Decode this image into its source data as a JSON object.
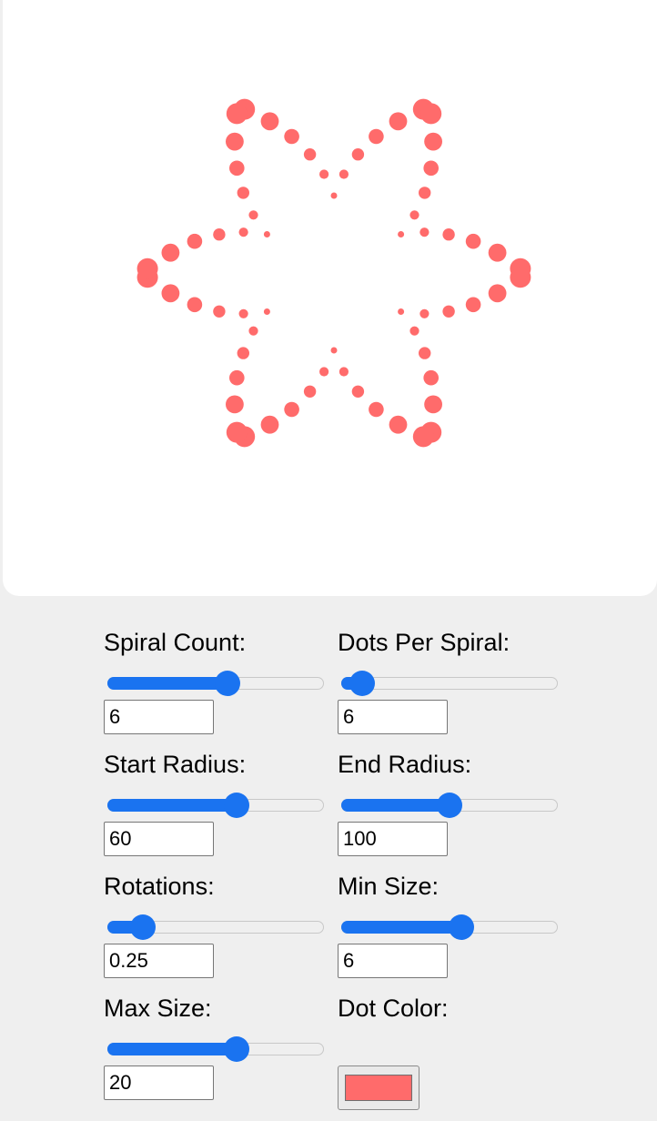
{
  "dot_color": "#ff6b6b",
  "accent_color": "#1a73f0",
  "controls": {
    "spiral_count": {
      "label": "Spiral Count:",
      "value": "6",
      "slider_fraction": 0.555
    },
    "dots_per_spiral": {
      "label": "Dots Per Spiral:",
      "value": "6",
      "slider_fraction": 0.095
    },
    "start_radius": {
      "label": "Start Radius:",
      "value": "60",
      "slider_fraction": 0.595
    },
    "end_radius": {
      "label": "End Radius:",
      "value": "100",
      "slider_fraction": 0.5
    },
    "rotations": {
      "label": "Rotations:",
      "value": "0.25",
      "slider_fraction": 0.165
    },
    "min_size": {
      "label": "Min Size:",
      "value": "6",
      "slider_fraction": 0.555
    },
    "max_size": {
      "label": "Max Size:",
      "value": "20",
      "slider_fraction": 0.595
    },
    "dot_color": {
      "label": "Dot Color:",
      "value": "#ff6b6b"
    }
  }
}
